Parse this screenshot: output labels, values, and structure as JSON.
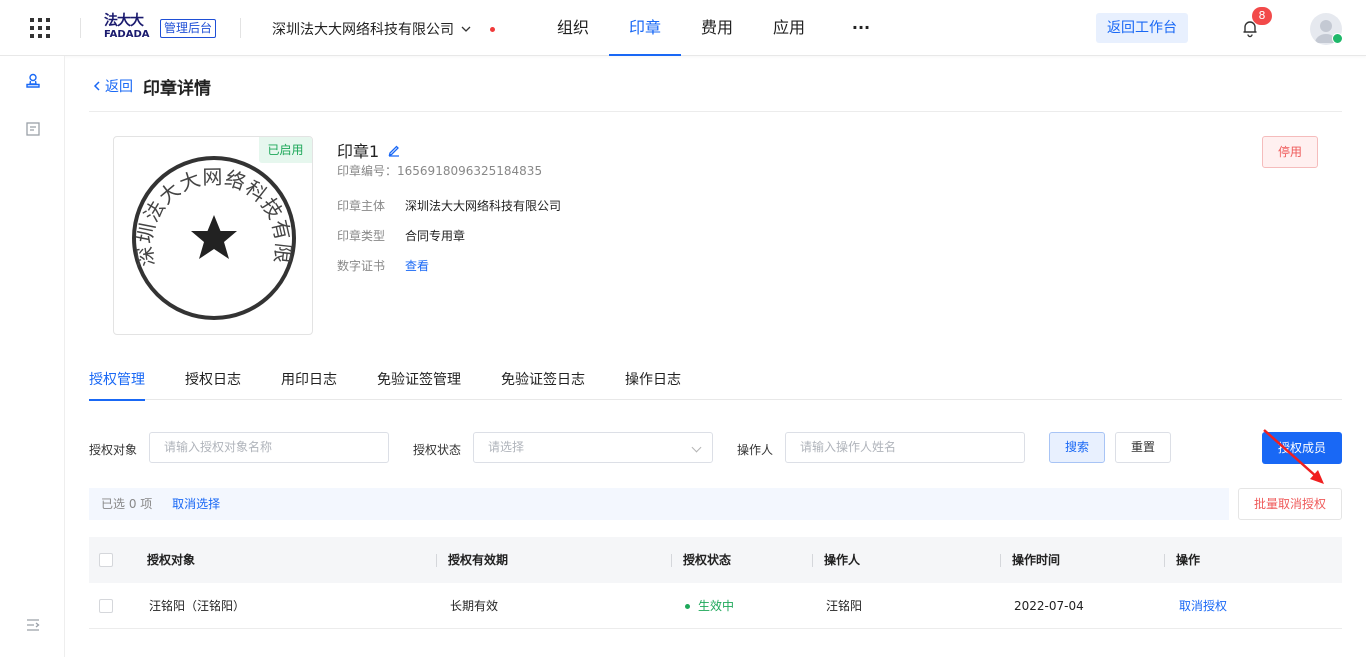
{
  "topbar": {
    "logo_cn": "法大大",
    "logo_en": "FADADA",
    "admin_badge": "管理后台",
    "company": "深圳法大大网络科技有限公司",
    "nav": [
      "组织",
      "印章",
      "费用",
      "应用"
    ],
    "nav_more": "···",
    "active_nav": "印章",
    "back_workbench": "返回工作台",
    "notification_count": "8"
  },
  "page": {
    "back": "返回",
    "title": "印章详情"
  },
  "seal": {
    "status_tag": "已启用",
    "name": "印章1",
    "number_label": "印章编号：",
    "number": "1656918096325184835",
    "stamp_text": "深圳法大大网络科技有限公司",
    "fields": [
      {
        "k": "印章主体",
        "v": "深圳法大大网络科技有限公司"
      },
      {
        "k": "印章类型",
        "v": "合同专用章"
      },
      {
        "k": "数字证书",
        "v": "查看"
      }
    ],
    "disable_btn": "停用"
  },
  "tabs": [
    "授权管理",
    "授权日志",
    "用印日志",
    "免验证签管理",
    "免验证签日志",
    "操作日志"
  ],
  "filters": {
    "target_label": "授权对象",
    "target_placeholder": "请输入授权对象名称",
    "status_label": "授权状态",
    "status_placeholder": "请选择",
    "operator_label": "操作人",
    "operator_placeholder": "请输入操作人姓名",
    "search_btn": "搜索",
    "reset_btn": "重置",
    "auth_btn": "授权成员"
  },
  "selection": {
    "selected": "已选 0 项",
    "cancel": "取消选择",
    "batch_cancel": "批量取消授权"
  },
  "table": {
    "headers": [
      "授权对象",
      "授权有效期",
      "授权状态",
      "操作人",
      "操作时间",
      "操作"
    ],
    "rows": [
      {
        "target": "汪铭阳（汪铭阳）",
        "validity": "长期有效",
        "status": "生效中",
        "operator": "汪铭阳",
        "time": "2022-07-04",
        "action": "取消授权"
      }
    ]
  },
  "colors": {
    "primary": "#1968f5",
    "success": "#1ea85a",
    "danger": "#ef5a5a"
  }
}
